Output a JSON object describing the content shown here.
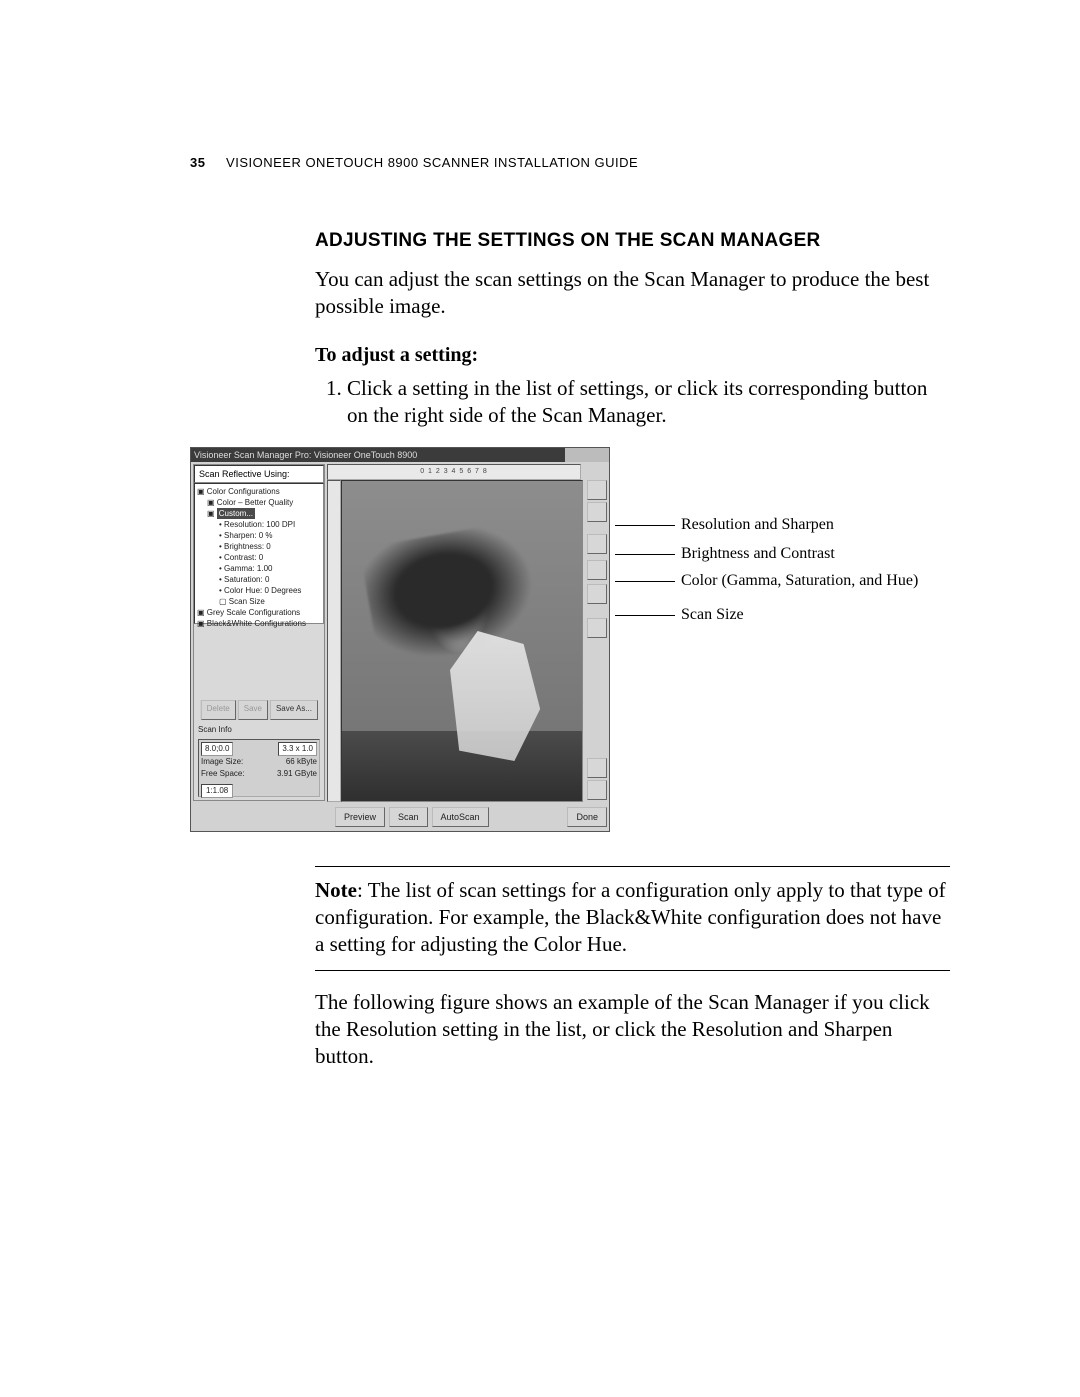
{
  "page_number": "35",
  "header_rest": "VISIONEER ONETOUCH 8900 SCANNER INSTALLATION GUIDE",
  "section_title": "ADJUSTING THE SETTINGS ON THE SCAN MANAGER",
  "intro": "You can adjust the scan settings on the Scan Manager to produce the best possible image.",
  "subhead": "To adjust a setting:",
  "step1": "Click a setting in the list of settings, or click its corresponding button on the right side of the Scan Manager.",
  "callouts": {
    "c1": "Resolution and Sharpen",
    "c2": "Brightness and Contrast",
    "c3": "Color (Gamma, Saturation, and Hue)",
    "c4": "Scan Size"
  },
  "screenshot": {
    "title": "Visioneer Scan Manager Pro: Visioneer OneTouch 8900",
    "dropdown": "Scan Reflective Using:",
    "tree": {
      "root1": "Color Configurations",
      "r1a": "Color – Better Quality",
      "r1b": "Custom...",
      "r1b1": "Resolution: 100 DPI",
      "r1b2": "Sharpen: 0 %",
      "r1b3": "Brightness: 0",
      "r1b4": "Contrast: 0",
      "r1b5": "Gamma: 1.00",
      "r1b6": "Saturation: 0",
      "r1b7": "Color Hue: 0 Degrees",
      "r1b8": "Scan Size",
      "root2": "Grey Scale Configurations",
      "root3": "Black&White Configurations"
    },
    "side_buttons": {
      "delete": "Delete",
      "save": "Save",
      "saveas": "Save As..."
    },
    "scaninfo_h": "Scan Info",
    "scaninfo": {
      "wh": "8.0;0.0",
      "dim2": "3.3 x 1.0",
      "imgsize_l": "Image Size:",
      "imgsize_v": "66 kByte",
      "free_l": "Free Space:",
      "free_v": "3.91 GByte",
      "time": "1:1.08"
    },
    "bottom": {
      "preview": "Preview",
      "scan": "Scan",
      "autoscan": "AutoScan",
      "done": "Done"
    },
    "ruler": "0     1     2     3     4     5     6     7     8"
  },
  "note_label": "Note",
  "note_body": ":  The list of scan settings for a configuration only apply to that type of configuration. For example, the Black&White configuration does not have a setting for adjusting the Color Hue.",
  "after_para": "The following figure shows an example of the Scan Manager if you click the Resolution setting in the list, or click the Resolution and Sharpen button."
}
